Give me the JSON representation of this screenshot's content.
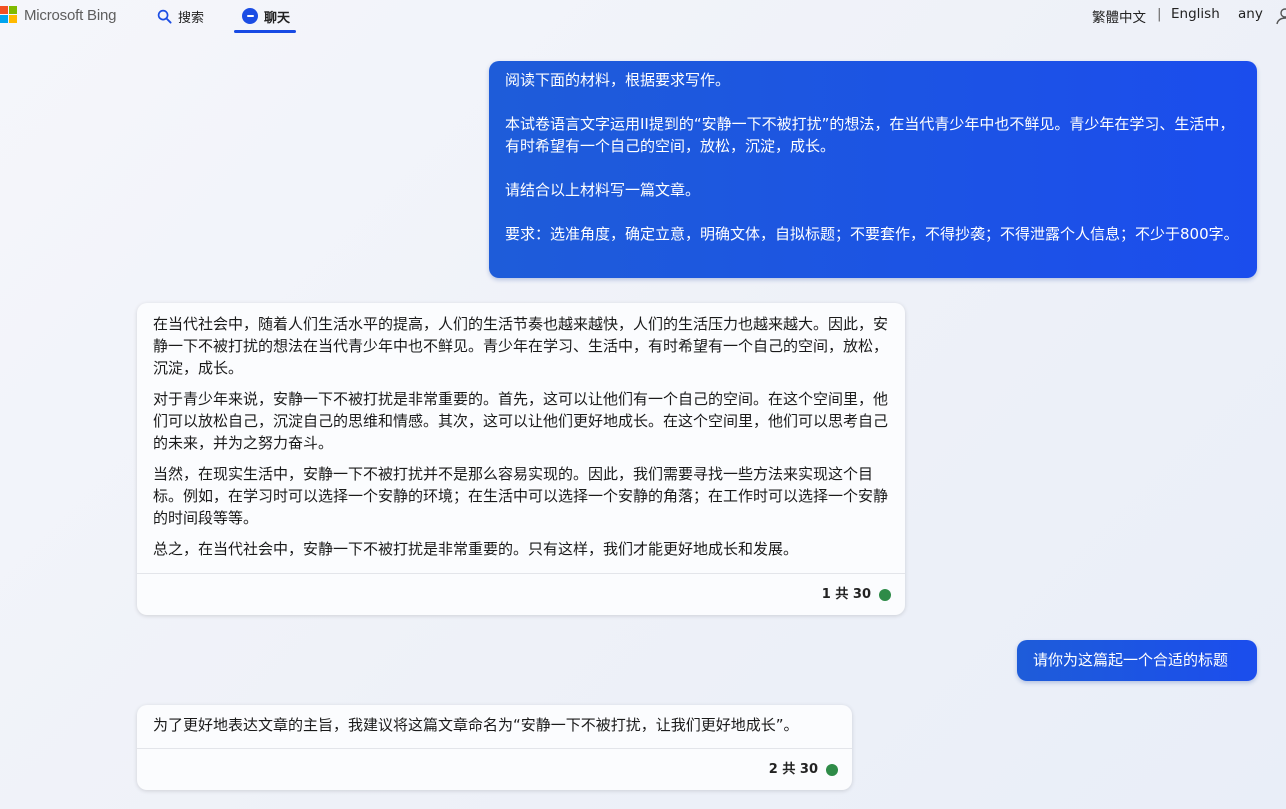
{
  "header": {
    "brand": "Microsoft Bing",
    "tabs": [
      {
        "label": "搜索",
        "icon": "search-icon"
      },
      {
        "label": "聊天",
        "icon": "chat-icon",
        "active": true
      }
    ],
    "lang_traditional": "繁體中文",
    "lang_separator": "|",
    "lang_english": "English",
    "user_name": "any",
    "accent_color": "#174ae4"
  },
  "messages": [
    {
      "role": "user",
      "paragraphs": [
        "阅读下面的材料，根据要求写作。",
        "本试卷语言文字运用II提到的“安静一下不被打扰”的想法，在当代青少年中也不鲜见。青少年在学习、生活中，有时希望有一个自己的空间，放松，沉淀，成长。",
        "请结合以上材料写一篇文章。",
        "要求：选准角度，确定立意，明确文体，自拟标题；不要套作，不得抄袭；不得泄露个人信息；不少于800字。"
      ]
    },
    {
      "role": "bot",
      "paragraphs": [
        "在当代社会中，随着人们生活水平的提高，人们的生活节奏也越来越快，人们的生活压力也越来越大。因此，安静一下不被打扰的想法在当代青少年中也不鲜见。青少年在学习、生活中，有时希望有一个自己的空间，放松，沉淀，成长。",
        "对于青少年来说，安静一下不被打扰是非常重要的。首先，这可以让他们有一个自己的空间。在这个空间里，他们可以放松自己，沉淀自己的思维和情感。其次，这可以让他们更好地成长。在这个空间里，他们可以思考自己的未来，并为之努力奋斗。",
        "当然，在现实生活中，安静一下不被打扰并不是那么容易实现的。因此，我们需要寻找一些方法来实现这个目标。例如，在学习时可以选择一个安静的环境；在生活中可以选择一个安静的角落；在工作时可以选择一个安静的时间段等等。",
        "总之，在当代社会中，安静一下不被打扰是非常重要的。只有这样，我们才能更好地成长和发展。"
      ],
      "counter": "1 共 30",
      "status_color": "#2e8b48"
    },
    {
      "role": "user",
      "text": "请你为这篇起一个合适的标题"
    },
    {
      "role": "bot",
      "text": "为了更好地表达文章的主旨，我建议将这篇文章命名为“安静一下不被打扰，让我们更好地成长”。",
      "counter": "2 共 30",
      "status_color": "#2e8b48"
    }
  ]
}
